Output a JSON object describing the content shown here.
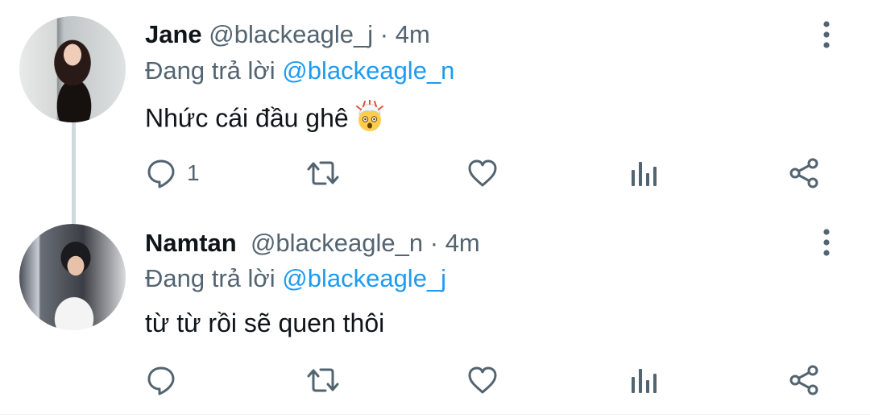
{
  "tweets": [
    {
      "name": "Jane",
      "handle": "@blackeagle_j",
      "separator": "·",
      "time": "4m",
      "reply_prefix": "Đang trả lời",
      "reply_to": "@blackeagle_n",
      "text": "Nhức cái đầu ghê",
      "emoji": "exploding-head-emoji",
      "reply_count": "1"
    },
    {
      "name": "Namtan",
      "handle": "@blackeagle_n",
      "separator": "·",
      "time": "4m",
      "reply_prefix": "Đang trả lời",
      "reply_to": "@blackeagle_j",
      "text": "từ từ rồi sẽ quen thôi",
      "reply_count": ""
    }
  ],
  "icons": {
    "reply": "reply-icon",
    "retweet": "retweet-icon",
    "like": "like-icon",
    "views": "views-icon",
    "share": "share-icon",
    "more": "more-icon"
  },
  "colors": {
    "icon": "#536471",
    "mention": "#1d9bf0",
    "thread_line": "#cfd9de",
    "text": "#0f1419"
  }
}
